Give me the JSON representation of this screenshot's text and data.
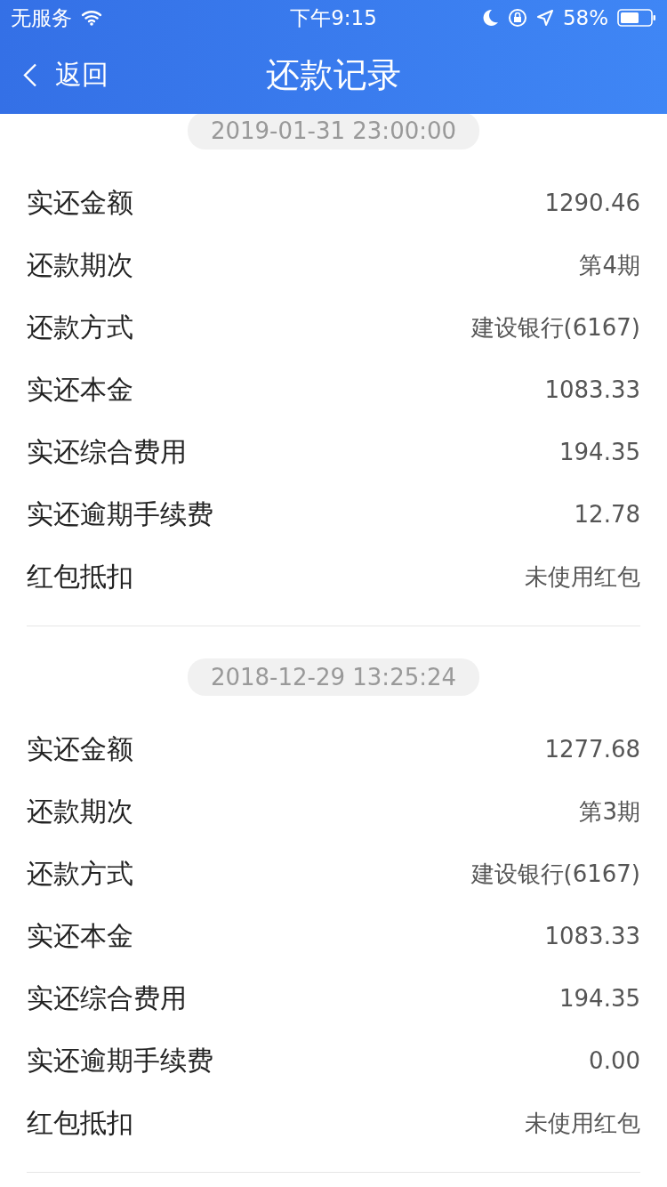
{
  "status_bar": {
    "carrier": "无服务",
    "time": "下午9:15",
    "battery": "58%"
  },
  "nav": {
    "back": "返回",
    "title": "还款记录"
  },
  "records": [
    {
      "date": "2019-01-31 23:00:00",
      "rows": [
        {
          "label": "实还金额",
          "value": "1290.46"
        },
        {
          "label": "还款期次",
          "value": "第4期"
        },
        {
          "label": "还款方式",
          "value": "建设银行(6167)"
        },
        {
          "label": "实还本金",
          "value": "1083.33"
        },
        {
          "label": "实还综合费用",
          "value": "194.35"
        },
        {
          "label": "实还逾期手续费",
          "value": "12.78"
        },
        {
          "label": "红包抵扣",
          "value": "未使用红包"
        }
      ]
    },
    {
      "date": "2018-12-29 13:25:24",
      "rows": [
        {
          "label": "实还金额",
          "value": "1277.68"
        },
        {
          "label": "还款期次",
          "value": "第3期"
        },
        {
          "label": "还款方式",
          "value": "建设银行(6167)"
        },
        {
          "label": "实还本金",
          "value": "1083.33"
        },
        {
          "label": "实还综合费用",
          "value": "194.35"
        },
        {
          "label": "实还逾期手续费",
          "value": "0.00"
        },
        {
          "label": "红包抵扣",
          "value": "未使用红包"
        }
      ]
    }
  ]
}
